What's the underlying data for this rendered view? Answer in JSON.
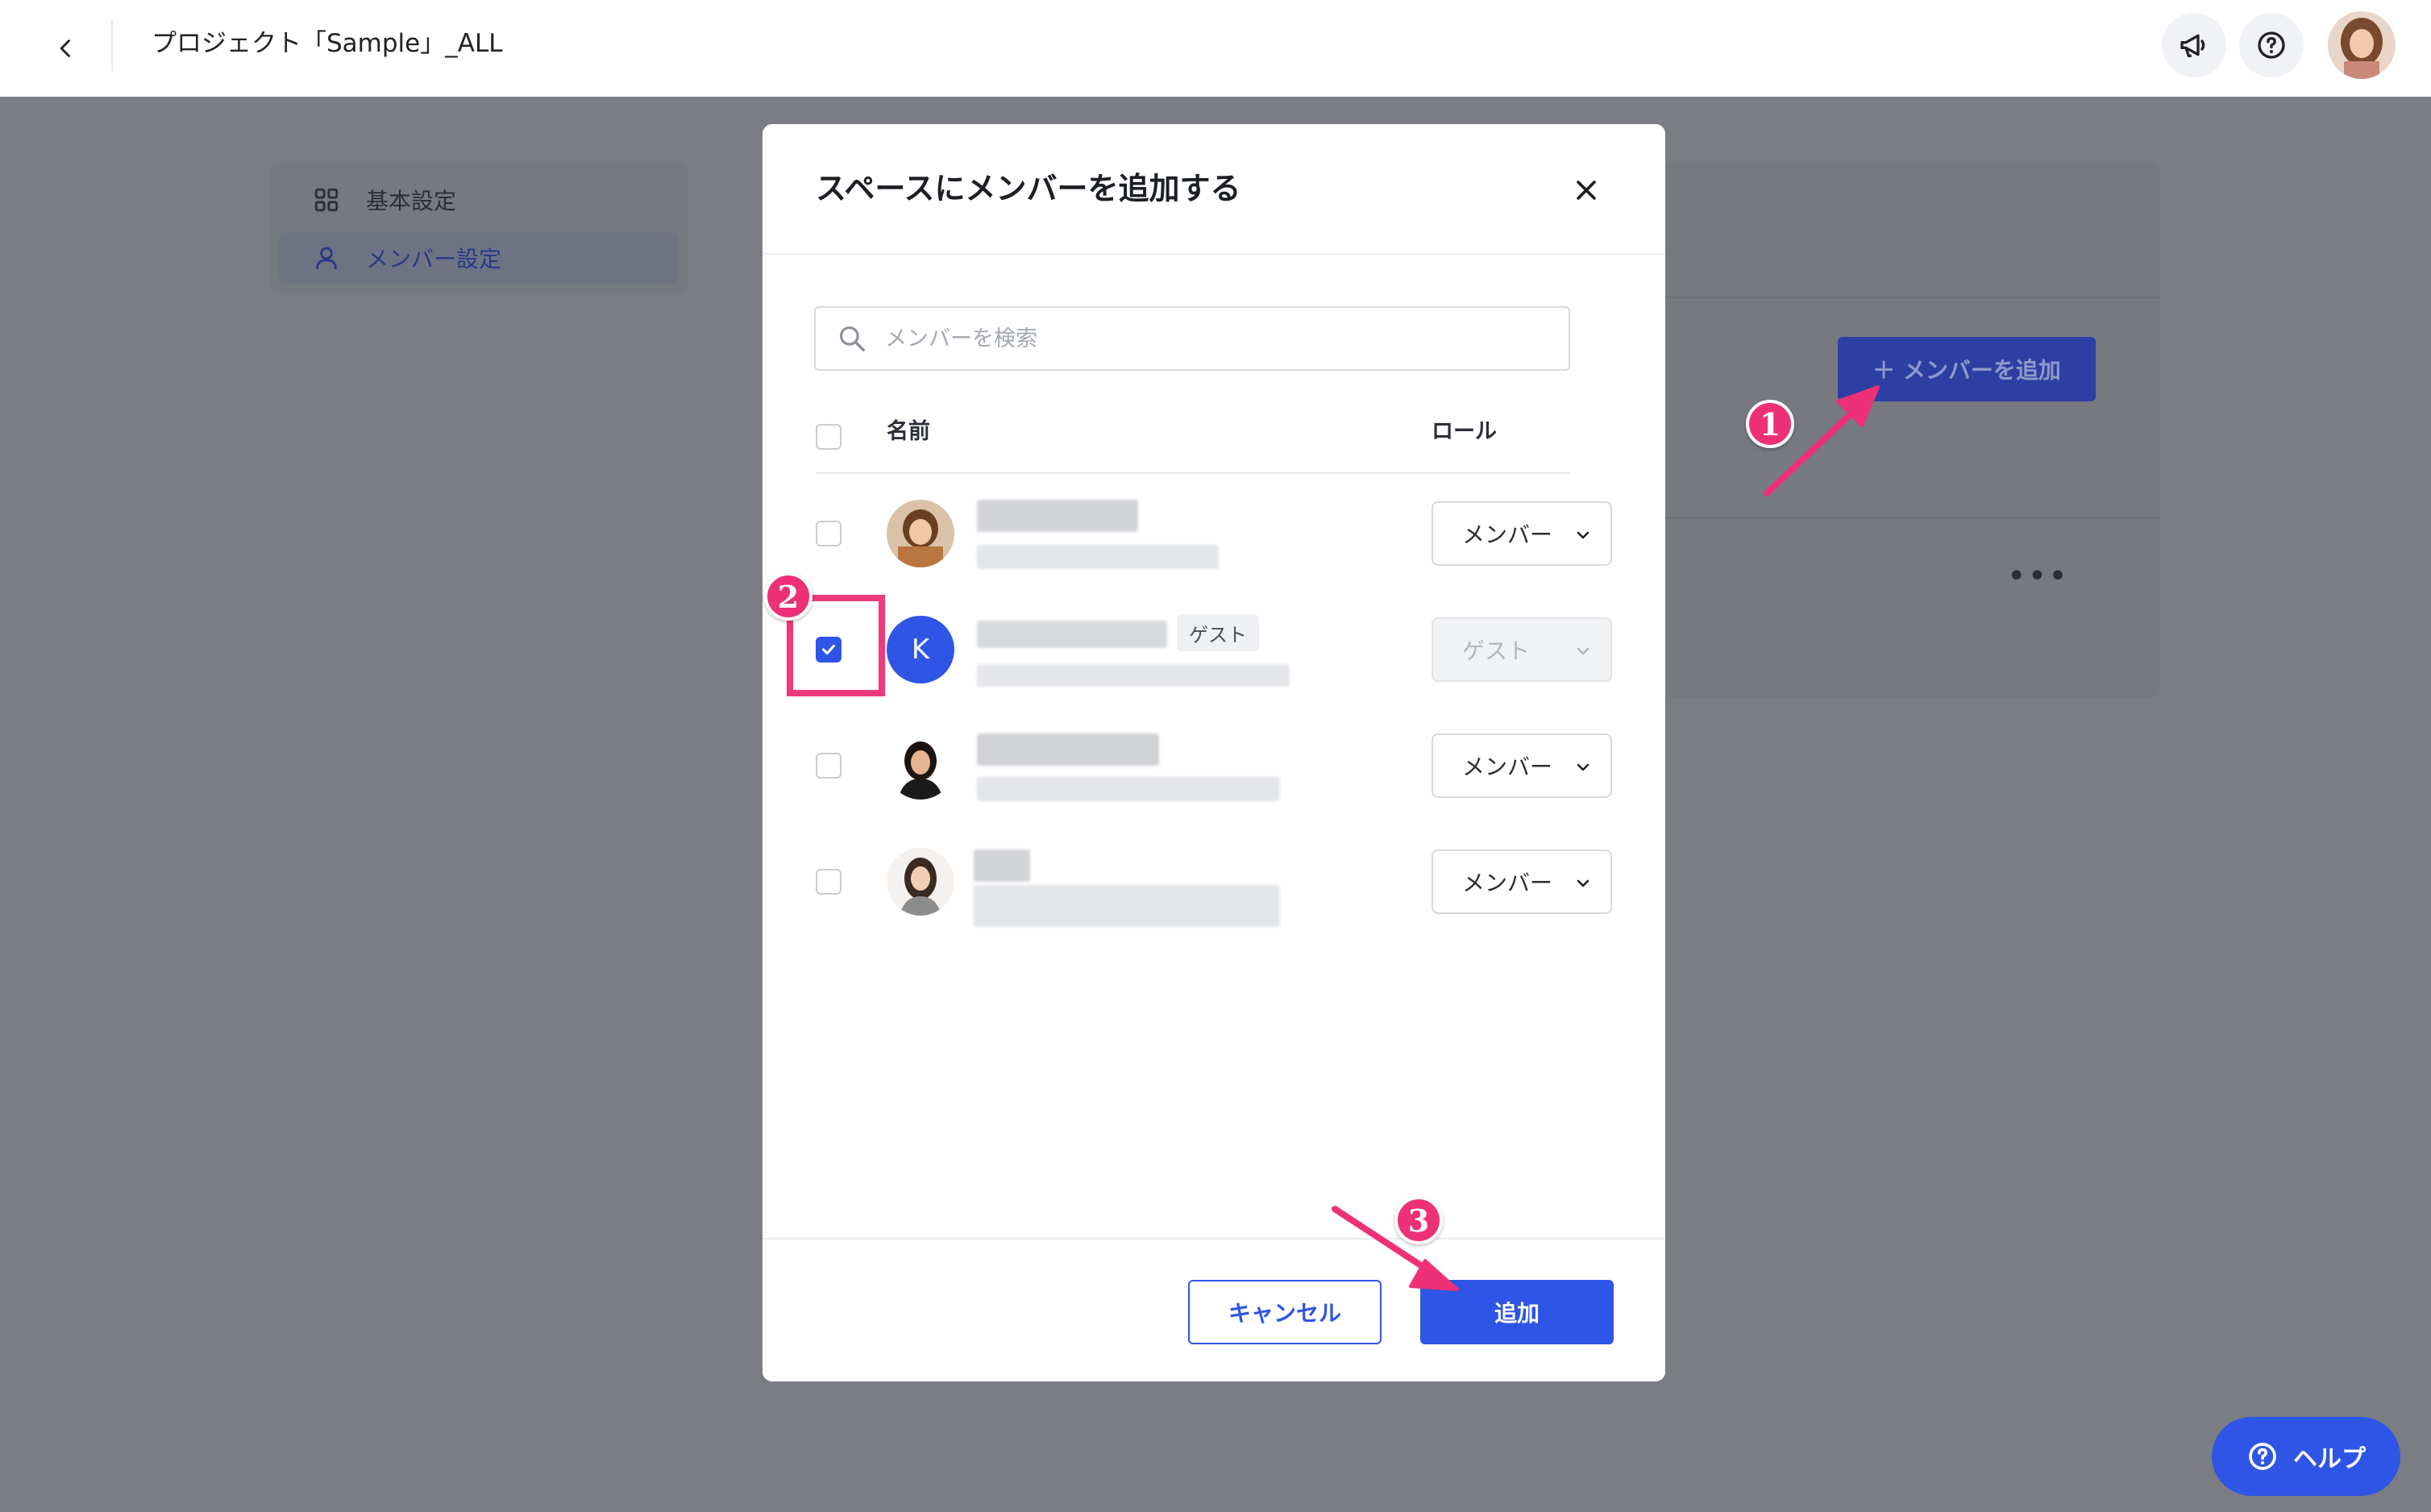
{
  "header": {
    "title": "プロジェクト「Sample」_ALL",
    "back_icon": "chevron-left-icon",
    "announce_icon": "megaphone-icon",
    "help_icon": "question-circle-icon"
  },
  "sidebar": {
    "items": [
      {
        "label": "基本設定",
        "icon": "grid-icon"
      },
      {
        "label": "メンバー設定",
        "icon": "user-icon"
      }
    ]
  },
  "background": {
    "add_member_label": "＋ メンバーを追加",
    "more_label": "•••"
  },
  "modal": {
    "title": "スペースにメンバーを追加する",
    "search_placeholder": "メンバーを検索",
    "col_name": "名前",
    "col_role": "ロール",
    "rows": [
      {
        "checked": false,
        "role": "メンバー",
        "avatar": "photo"
      },
      {
        "checked": true,
        "role": "ゲスト",
        "avatar": "K",
        "tag": "ゲスト",
        "role_disabled": true
      },
      {
        "checked": false,
        "role": "メンバー",
        "avatar": "photo"
      },
      {
        "checked": false,
        "role": "メンバー",
        "avatar": "photo"
      }
    ],
    "cancel_label": "キャンセル",
    "add_label": "追加"
  },
  "annotations": {
    "step1": "1",
    "step2": "2",
    "step3": "3",
    "color": "#ee3177"
  },
  "help_button": {
    "label": "ヘルプ"
  },
  "colors": {
    "accent": "#2f55e6",
    "overlay": "#7b7d83",
    "annotation": "#ee3177"
  }
}
